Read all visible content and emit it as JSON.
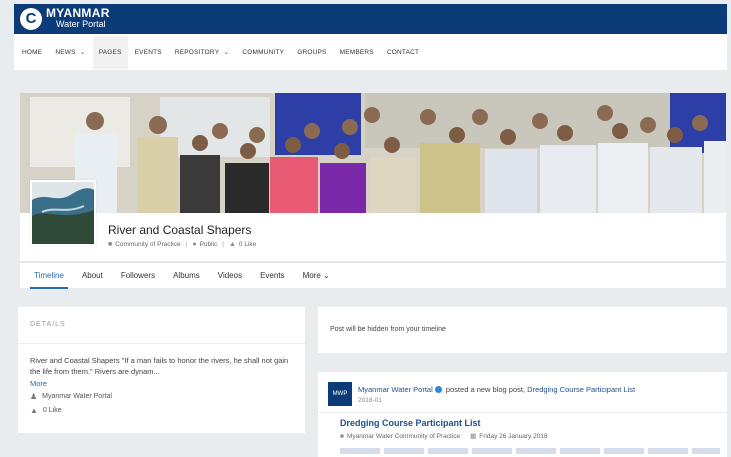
{
  "header": {
    "logo_mark": "C",
    "logo_title": "MYANMAR",
    "logo_subtitle": "Water Portal",
    "brand_color": "#0c3c78"
  },
  "nav": {
    "items": [
      {
        "label": "HOME",
        "has_dropdown": false
      },
      {
        "label": "NEWS",
        "has_dropdown": true
      },
      {
        "label": "PAGES",
        "has_dropdown": false,
        "active": true
      },
      {
        "label": "EVENTS",
        "has_dropdown": false
      },
      {
        "label": "REPOSITORY",
        "has_dropdown": true
      },
      {
        "label": "COMMUNITY",
        "has_dropdown": false
      },
      {
        "label": "GROUPS",
        "has_dropdown": false
      },
      {
        "label": "MEMBERS",
        "has_dropdown": false
      },
      {
        "label": "CONTACT",
        "has_dropdown": false
      }
    ]
  },
  "profile": {
    "name": "River and Coastal Shapers",
    "category": "Community of Practice",
    "privacy": "Public",
    "likes": "0 Like"
  },
  "tabs": [
    {
      "label": "Timeline",
      "active": true
    },
    {
      "label": "About"
    },
    {
      "label": "Followers"
    },
    {
      "label": "Albums"
    },
    {
      "label": "Videos"
    },
    {
      "label": "Events"
    },
    {
      "label": "More"
    }
  ],
  "details": {
    "title": "DETAILS",
    "description": "River and Coastal Shapers \"If a man fails to honor the rivers, he shall not gain the life from them.\" Rivers are dynam...",
    "more_label": "More",
    "owner": "Myanmar Water Portal",
    "likes": "0 Like"
  },
  "hidden_note": "Post will be hidden from your timeline",
  "post": {
    "author": "Myanmar Water Portal",
    "action": "posted a new blog post,",
    "link": "Dredging Course Participant List",
    "date": "2018-01",
    "title": "Dredging Course Participant List",
    "group": "Myanmar Water Community of Practice",
    "published": "Friday 26 January 2018"
  }
}
